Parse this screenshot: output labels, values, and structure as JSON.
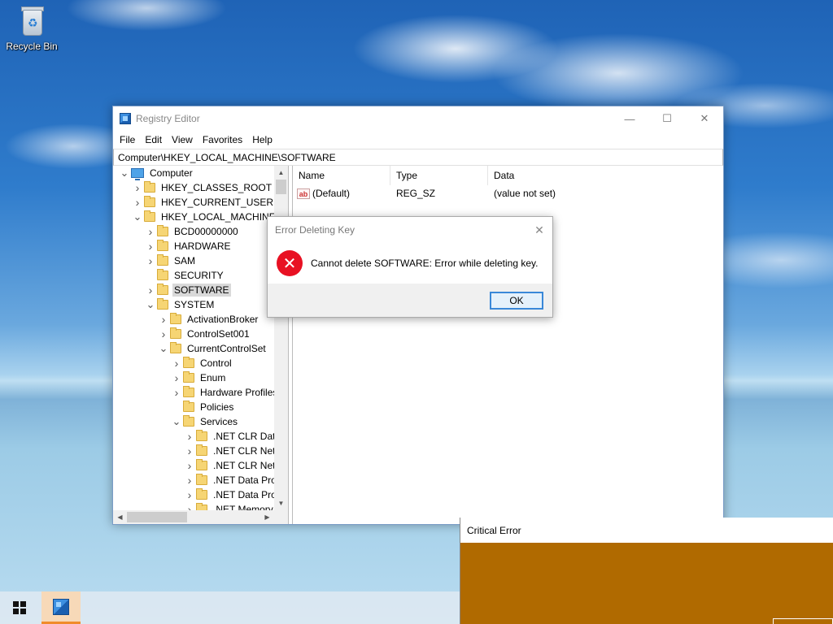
{
  "desktop": {
    "recycle_bin_label": "Recycle Bin"
  },
  "regedit": {
    "title": "Registry Editor",
    "window_controls": {
      "minimize": "—",
      "maximize": "☐",
      "close": "✕"
    },
    "menu": [
      "File",
      "Edit",
      "View",
      "Favorites",
      "Help"
    ],
    "address": "Computer\\HKEY_LOCAL_MACHINE\\SOFTWARE",
    "tree": [
      {
        "label": "Computer",
        "depth": 0,
        "chevron": "expanded",
        "icon": "computer-icon"
      },
      {
        "label": "HKEY_CLASSES_ROOT",
        "depth": 1,
        "chevron": "collapsed",
        "icon": "folder-icon"
      },
      {
        "label": "HKEY_CURRENT_USER",
        "depth": 1,
        "chevron": "collapsed",
        "icon": "folder-icon"
      },
      {
        "label": "HKEY_LOCAL_MACHINE",
        "depth": 1,
        "chevron": "expanded",
        "icon": "folder-icon"
      },
      {
        "label": "BCD00000000",
        "depth": 2,
        "chevron": "collapsed",
        "icon": "folder-icon"
      },
      {
        "label": "HARDWARE",
        "depth": 2,
        "chevron": "collapsed",
        "icon": "folder-icon"
      },
      {
        "label": "SAM",
        "depth": 2,
        "chevron": "collapsed",
        "icon": "folder-icon"
      },
      {
        "label": "SECURITY",
        "depth": 2,
        "chevron": "none",
        "icon": "folder-icon"
      },
      {
        "label": "SOFTWARE",
        "depth": 2,
        "chevron": "collapsed",
        "icon": "folder-icon",
        "selected": true
      },
      {
        "label": "SYSTEM",
        "depth": 2,
        "chevron": "expanded",
        "icon": "folder-icon"
      },
      {
        "label": "ActivationBroker",
        "depth": 3,
        "chevron": "collapsed",
        "icon": "folder-icon"
      },
      {
        "label": "ControlSet001",
        "depth": 3,
        "chevron": "collapsed",
        "icon": "folder-icon"
      },
      {
        "label": "CurrentControlSet",
        "depth": 3,
        "chevron": "expanded",
        "icon": "folder-icon"
      },
      {
        "label": "Control",
        "depth": 4,
        "chevron": "collapsed",
        "icon": "folder-icon"
      },
      {
        "label": "Enum",
        "depth": 4,
        "chevron": "collapsed",
        "icon": "folder-icon"
      },
      {
        "label": "Hardware Profiles",
        "depth": 4,
        "chevron": "collapsed",
        "icon": "folder-icon"
      },
      {
        "label": "Policies",
        "depth": 4,
        "chevron": "none",
        "icon": "folder-icon"
      },
      {
        "label": "Services",
        "depth": 4,
        "chevron": "expanded",
        "icon": "folder-icon"
      },
      {
        "label": ".NET CLR Data",
        "depth": 5,
        "chevron": "collapsed",
        "icon": "folder-icon"
      },
      {
        "label": ".NET CLR Netw",
        "depth": 5,
        "chevron": "collapsed",
        "icon": "folder-icon"
      },
      {
        "label": ".NET CLR Netw",
        "depth": 5,
        "chevron": "collapsed",
        "icon": "folder-icon"
      },
      {
        "label": ".NET Data Prov",
        "depth": 5,
        "chevron": "collapsed",
        "icon": "folder-icon"
      },
      {
        "label": ".NET Data Prov",
        "depth": 5,
        "chevron": "collapsed",
        "icon": "folder-icon"
      },
      {
        "label": ".NET Memory",
        "depth": 5,
        "chevron": "collapsed",
        "icon": "folder-icon"
      }
    ],
    "columns": {
      "name": "Name",
      "type": "Type",
      "data": "Data"
    },
    "values": [
      {
        "name": "(Default)",
        "type": "REG_SZ",
        "data": "(value not set)",
        "icon": "ab"
      }
    ]
  },
  "error_dialog": {
    "title": "Error Deleting Key",
    "close": "✕",
    "icon": "error-icon",
    "message": "Cannot delete SOFTWARE:  Error while deleting key.",
    "ok_label": "OK"
  },
  "critical_error": {
    "title": "Critical Error",
    "body_color": "#b06a00"
  }
}
